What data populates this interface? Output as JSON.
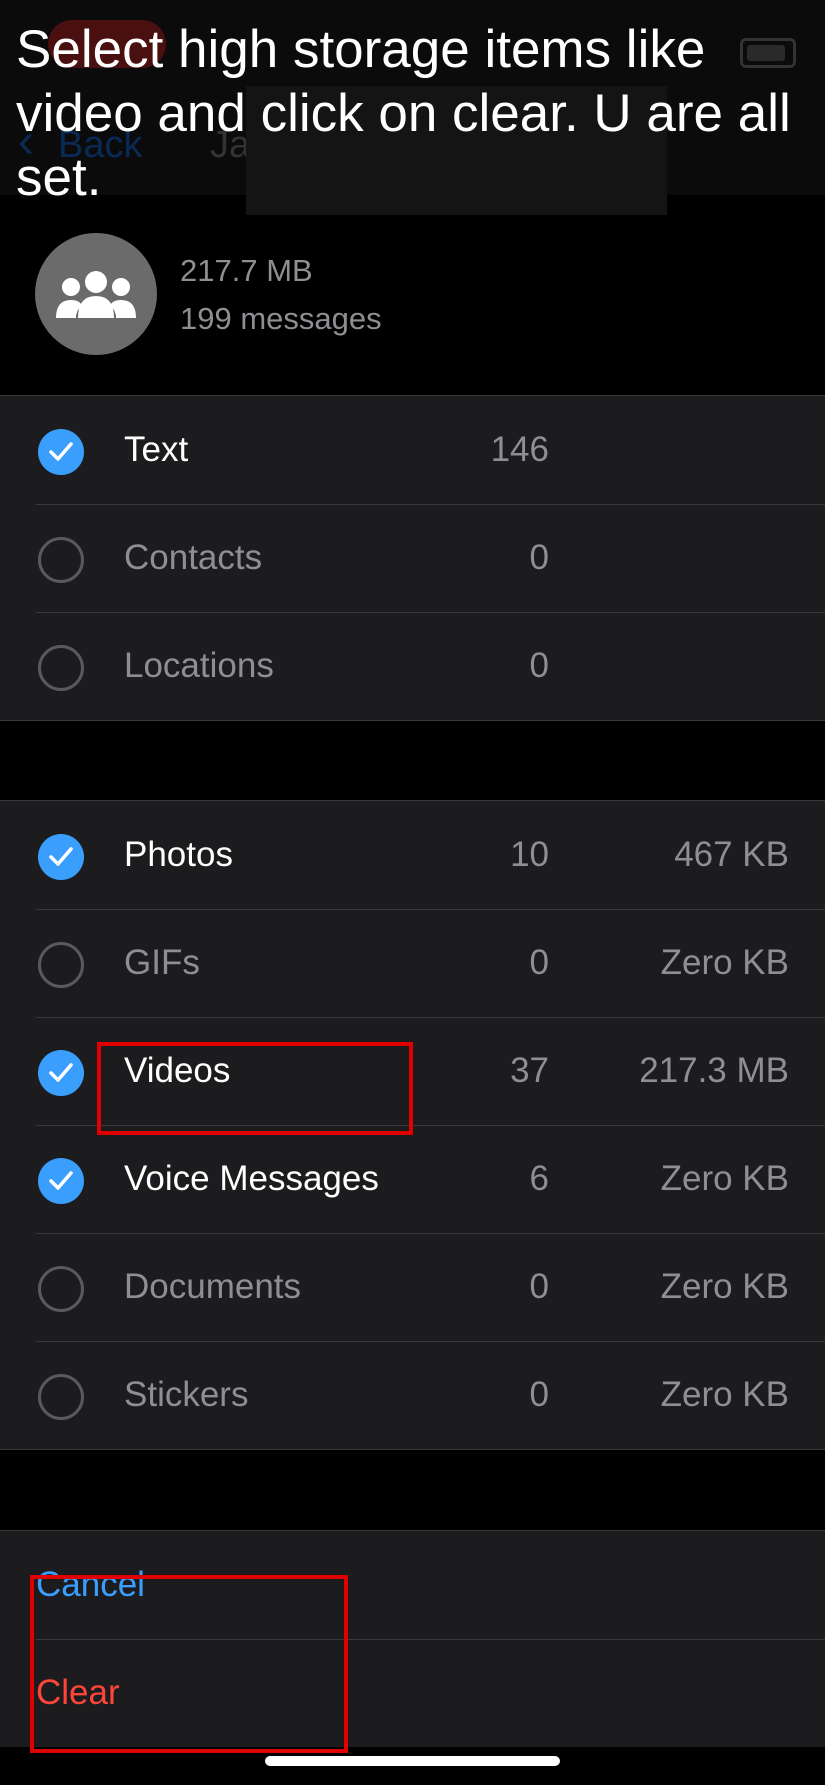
{
  "caption": "Select high storage items like video and click on clear. U are all set.",
  "nav": {
    "back_label": "Back",
    "title": "Ja"
  },
  "chat": {
    "size": "217.7 MB",
    "messages": "199 messages",
    "avatar_icon": "group-icon"
  },
  "section1": [
    {
      "label": "Text",
      "checked": true,
      "count": "146"
    },
    {
      "label": "Contacts",
      "checked": false,
      "count": "0"
    },
    {
      "label": "Locations",
      "checked": false,
      "count": "0"
    }
  ],
  "section2": [
    {
      "label": "Photos",
      "checked": true,
      "count": "10",
      "size": "467 KB"
    },
    {
      "label": "GIFs",
      "checked": false,
      "count": "0",
      "size": "Zero KB"
    },
    {
      "label": "Videos",
      "checked": true,
      "count": "37",
      "size": "217.3 MB"
    },
    {
      "label": "Voice Messages",
      "checked": true,
      "count": "6",
      "size": "Zero KB"
    },
    {
      "label": "Documents",
      "checked": false,
      "count": "0",
      "size": "Zero KB"
    },
    {
      "label": "Stickers",
      "checked": false,
      "count": "0",
      "size": "Zero KB"
    }
  ],
  "actions": {
    "cancel": "Cancel",
    "clear": "Clear"
  },
  "colors": {
    "accent": "#3a9efd",
    "destructive": "#ff453a",
    "highlight": "#e00000"
  }
}
